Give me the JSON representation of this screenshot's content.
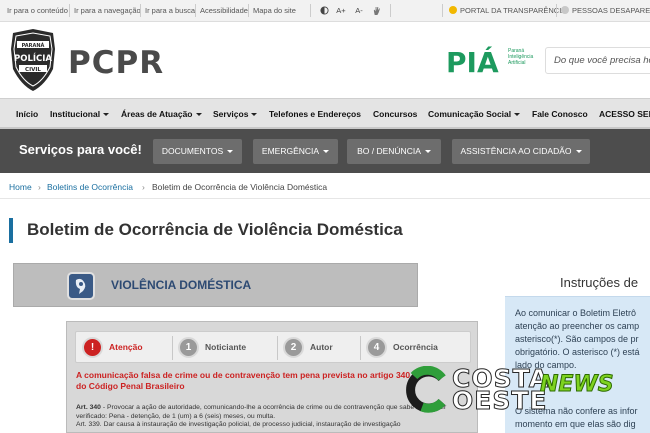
{
  "accessibility_bar": {
    "links": [
      "Ir para o conteúdo",
      "Ir para a navegação",
      "Ir para a busca",
      "Acessibilidade",
      "Mapa do site"
    ],
    "font_controls": [
      "A+",
      "A-"
    ],
    "transparency_label": "PORTAL DA TRANSPARÊNCIA",
    "missing_people_label": "PESSOAS DESAPARECIDAS"
  },
  "header": {
    "badge_top": "PARANÁ",
    "badge_mid": "POLÍCIA",
    "badge_bottom": "CIVIL",
    "brand": "PCPR",
    "pia_logo_text": "PIÁ",
    "pia_subtitle": [
      "Paraná",
      "Inteligência",
      "Artificial"
    ],
    "search_placeholder": "Do que você precisa hoje?"
  },
  "main_nav": {
    "items": [
      {
        "label": "Início",
        "dropdown": false
      },
      {
        "label": "Institucional",
        "dropdown": true
      },
      {
        "label": "Áreas de Atuação",
        "dropdown": true
      },
      {
        "label": "Serviços",
        "dropdown": true
      },
      {
        "label": "Telefones e Endereços",
        "dropdown": false
      },
      {
        "label": "Concursos",
        "dropdown": false
      },
      {
        "label": "Comunicação Social",
        "dropdown": true
      },
      {
        "label": "Fale Conosco",
        "dropdown": false
      },
      {
        "label": "ACESSO SEI",
        "dropdown": false
      }
    ]
  },
  "services_bar": {
    "title": "Serviços para você!",
    "buttons": [
      "DOCUMENTOS",
      "EMERGÊNCIA",
      "BO / DENÚNCIA",
      "ASSISTÊNCIA AO CIDADÃO"
    ]
  },
  "breadcrumb": {
    "items": [
      "Home",
      "Boletins de Ocorrência",
      "Boletim de Ocorrência de Violência Doméstica"
    ],
    "separator": "›"
  },
  "page": {
    "title": "Boletim de Ocorrência de Violência Doméstica"
  },
  "banner": {
    "label": "VIOLÊNCIA DOMÉSTICA"
  },
  "steps": [
    {
      "number": "!",
      "label": "Atenção",
      "active": true
    },
    {
      "number": "1",
      "label": "Noticiante",
      "active": false
    },
    {
      "number": "2",
      "label": "Autor",
      "active": false
    },
    {
      "number": "4",
      "label": "Ocorrência",
      "active": false
    }
  ],
  "warning_text": "A comunicação falsa de crime ou de contravenção tem pena prevista no artigo 340 do Código Penal Brasileiro",
  "law_text": {
    "art340_label": "Art. 340",
    "art340_body": " - Provocar a ação de autoridade, comunicando-lhe a ocorrência de crime ou de contravenção que sabe não se ter verificado: Pena - detenção, de 1 (um) a 6 (seis) meses, ou multa.",
    "art339": "Art. 339. Dar causa à instauração de investigação policial, de processo judicial, instauração de investigação"
  },
  "sidebar": {
    "title": "Instruções de",
    "paragraph1_lines": [
      "Ao comunicar o Boletim Eletrô",
      "atenção ao preencher os camp",
      "asterisco(*). São campos de pr",
      "obrigatório. O asterisco (*) está",
      "lado do campo."
    ],
    "paragraph2_lines": [
      "O sistema não confere as infor",
      "momento em que elas são dig"
    ]
  },
  "watermark": {
    "word1": "COSTA",
    "word2": "OESTE",
    "word3": "NEWS"
  },
  "colors": {
    "link_blue": "#1a6fa0",
    "active_red": "#cc2222",
    "services_bg": "#4d4d4d",
    "info_bg": "#d7e8f6",
    "news_green": "#7ed321"
  }
}
